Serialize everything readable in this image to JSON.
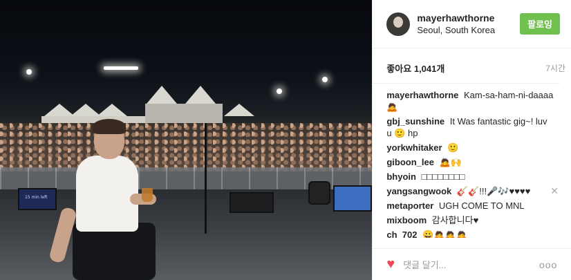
{
  "header": {
    "username": "mayerhawthorne",
    "location": "Seoul, South Korea",
    "follow_label": "팔로잉"
  },
  "stats": {
    "likes": "좋아요 1,041개",
    "time": "7시간"
  },
  "photo": {
    "monitor_text": "15 min left"
  },
  "comments": [
    {
      "user": "mayerhawthorne",
      "text": "Kam-sa-ham-ni-daaaa 🙇"
    },
    {
      "user": "gbj_sunshine",
      "text": "It Was fantastic gig~! luv u 🙂 hp"
    },
    {
      "user": "yorkwhitaker",
      "text": "🙂"
    },
    {
      "user": "giboon_lee",
      "text": "🙇🙌"
    },
    {
      "user": "bhyoin",
      "text": "□□□□□□□□"
    },
    {
      "user": "yangsangwook",
      "text": "🎸🎸!!!🎤🎶♥♥♥♥"
    },
    {
      "user": "metaporter",
      "text": "UGH COME TO MNL"
    },
    {
      "user": "mixboom",
      "text": "감사합니다♥"
    },
    {
      "user": "ch_702",
      "text": "😀🙇🙇🙇"
    }
  ],
  "footer": {
    "comment_placeholder": "댓글 달기...",
    "more": "ooo"
  },
  "colors": {
    "follow_bg": "#70c050",
    "heart": "#ed4956"
  }
}
